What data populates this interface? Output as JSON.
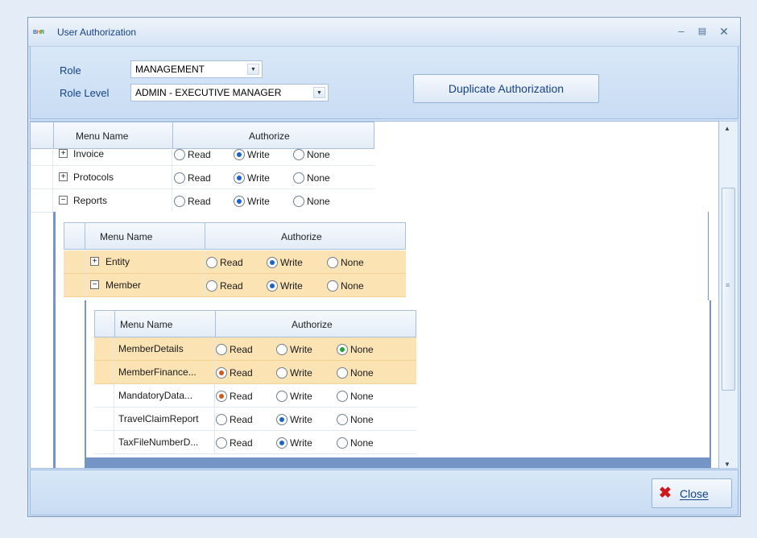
{
  "window": {
    "title": "User Authorization",
    "app_icon": [
      "B",
      "H",
      "R"
    ],
    "minimize_icon": "minimize-icon",
    "maximize_icon": "maximize-icon",
    "close_icon": "close-icon"
  },
  "header": {
    "role_label": "Role",
    "role_value": "MANAGEMENT",
    "role_level_label": "Role Level",
    "role_level_value": "ADMIN - EXECUTIVE MANAGER",
    "duplicate_button": "Duplicate Authorization"
  },
  "grid": {
    "col_menu_name": "Menu Name",
    "col_authorize": "Authorize",
    "options": [
      "Read",
      "Write",
      "None"
    ],
    "rows": [
      {
        "name": "Invoice",
        "expander": "+",
        "selected": "Write"
      },
      {
        "name": "Protocols",
        "expander": "+",
        "selected": "Write"
      },
      {
        "name": "Reports",
        "expander": "-",
        "selected": "Write"
      }
    ],
    "level2": {
      "col_menu_name": "Menu Name",
      "col_authorize": "Authorize",
      "rows": [
        {
          "name": "Entity",
          "expander": "+",
          "selected": "Write"
        },
        {
          "name": "Member",
          "expander": "-",
          "selected": "Write"
        }
      ]
    },
    "level3": {
      "col_menu_name": "Menu Name",
      "col_authorize": "Authorize",
      "rows": [
        {
          "name": "MemberDetails",
          "selected": "None"
        },
        {
          "name": "MemberFinance...",
          "selected": "Read"
        },
        {
          "name": "MandatoryData...",
          "selected": "Read"
        },
        {
          "name": "TravelClaimReport",
          "selected": "Write"
        },
        {
          "name": "TaxFileNumberD...",
          "selected": "Write"
        }
      ]
    }
  },
  "footer": {
    "close_button": "Close"
  },
  "colors": {
    "accent": "#15428b",
    "highlight_row": "#fbe3b4",
    "radio_write": "#1b63c8",
    "radio_none": "#22a533",
    "radio_read": "#d05a1a"
  }
}
